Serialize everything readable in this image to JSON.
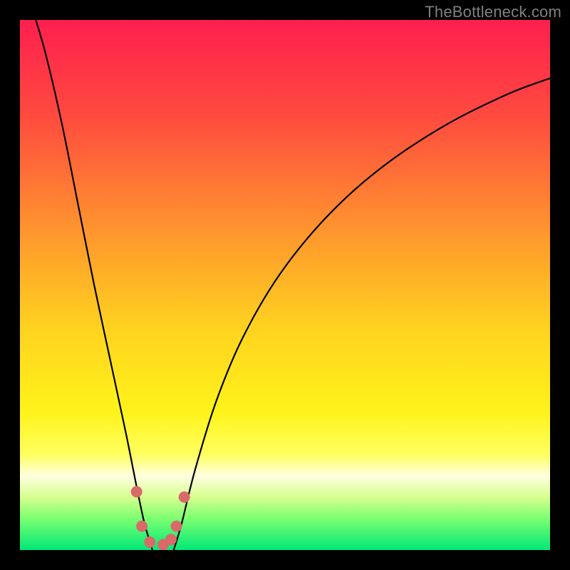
{
  "watermark": "TheBottleneck.com",
  "colors": {
    "frame": "#000000",
    "curve": "#000000",
    "marker_fill": "#d86a6a",
    "marker_stroke": "#c85050",
    "gradient_stops": [
      {
        "offset": 0.0,
        "color": "#ff1f4f"
      },
      {
        "offset": 0.18,
        "color": "#ff4a3f"
      },
      {
        "offset": 0.38,
        "color": "#ff8f2f"
      },
      {
        "offset": 0.58,
        "color": "#ffd21f"
      },
      {
        "offset": 0.74,
        "color": "#fff31a"
      },
      {
        "offset": 0.82,
        "color": "#ffff60"
      },
      {
        "offset": 0.86,
        "color": "#ffffe0"
      },
      {
        "offset": 0.9,
        "color": "#d8ff90"
      },
      {
        "offset": 0.94,
        "color": "#7cff70"
      },
      {
        "offset": 1.0,
        "color": "#00e878"
      }
    ]
  },
  "chart_data": {
    "type": "line",
    "x_range": [
      0,
      100
    ],
    "y_range": [
      0,
      100
    ],
    "left_curve": [
      {
        "x": 3,
        "y": 100
      },
      {
        "x": 5,
        "y": 93
      },
      {
        "x": 8,
        "y": 80
      },
      {
        "x": 11,
        "y": 65
      },
      {
        "x": 14,
        "y": 50
      },
      {
        "x": 17,
        "y": 36
      },
      {
        "x": 20,
        "y": 22
      },
      {
        "x": 22,
        "y": 12
      },
      {
        "x": 23.5,
        "y": 5
      },
      {
        "x": 25,
        "y": 0
      }
    ],
    "right_curve": [
      {
        "x": 29,
        "y": 0
      },
      {
        "x": 30.5,
        "y": 5
      },
      {
        "x": 33,
        "y": 15
      },
      {
        "x": 37,
        "y": 28
      },
      {
        "x": 42,
        "y": 40
      },
      {
        "x": 49,
        "y": 52
      },
      {
        "x": 58,
        "y": 63
      },
      {
        "x": 68,
        "y": 72
      },
      {
        "x": 80,
        "y": 80
      },
      {
        "x": 92,
        "y": 86
      },
      {
        "x": 100,
        "y": 89
      }
    ],
    "markers": [
      {
        "x": 22,
        "y": 11
      },
      {
        "x": 23,
        "y": 4.5
      },
      {
        "x": 24.5,
        "y": 1.5
      },
      {
        "x": 27,
        "y": 1
      },
      {
        "x": 28.5,
        "y": 2
      },
      {
        "x": 29.5,
        "y": 4.5
      },
      {
        "x": 31,
        "y": 10
      }
    ],
    "title": "",
    "xlabel": "",
    "ylabel": ""
  }
}
